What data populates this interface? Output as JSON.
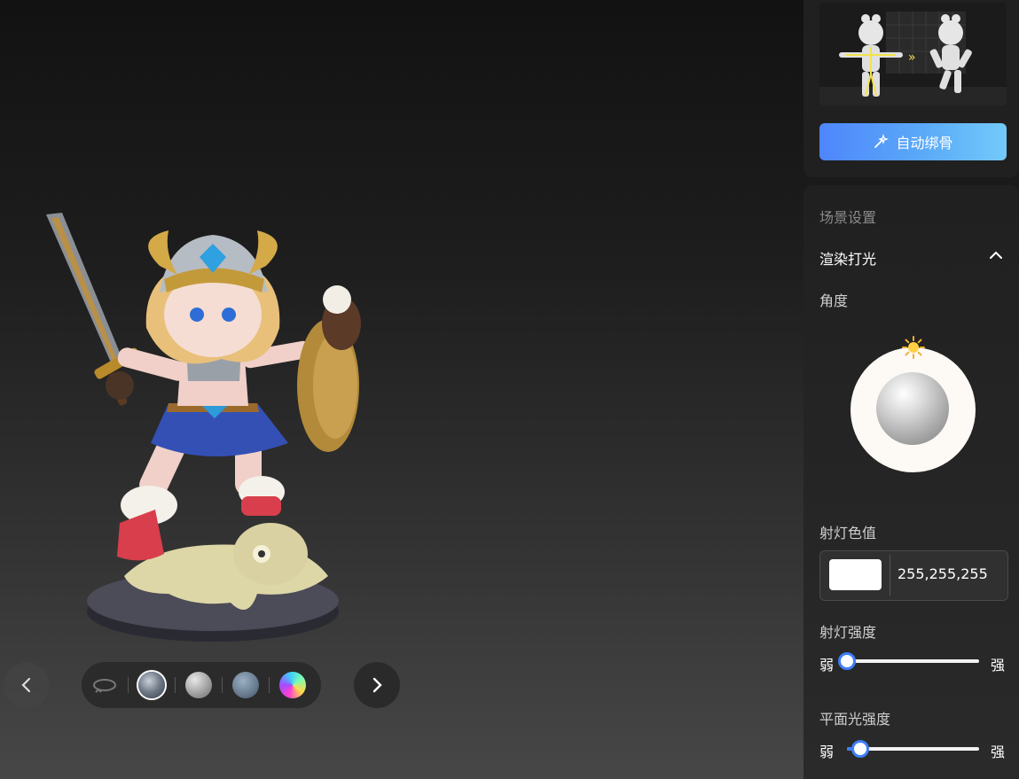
{
  "auto_rig": {
    "label": "自动绑骨"
  },
  "scene": {
    "section_title": "场景设置",
    "render_light": {
      "title": "渲染打光",
      "angle_label": "角度",
      "spot_color_label": "射灯色值",
      "spot_color_value": "255,255,255",
      "spot_color_hex": "#ffffff",
      "spot_intensity_label": "射灯强度",
      "spot_intensity_min": "弱",
      "spot_intensity_max": "强",
      "spot_intensity_fraction": 0.0,
      "flat_intensity_label": "平面光强度",
      "flat_intensity_min": "弱",
      "flat_intensity_max": "强",
      "flat_intensity_fraction": 0.1
    }
  },
  "toolbar": {
    "selected_material": "material-metal-dark",
    "materials": [
      "rotate-icon",
      "material-metal-dark",
      "material-gray-matte",
      "material-stone",
      "material-gradient"
    ]
  },
  "colors": {
    "accent": "#3d7ff7",
    "button_gradient_start": "#4e86fb",
    "button_gradient_end": "#73cafa"
  }
}
